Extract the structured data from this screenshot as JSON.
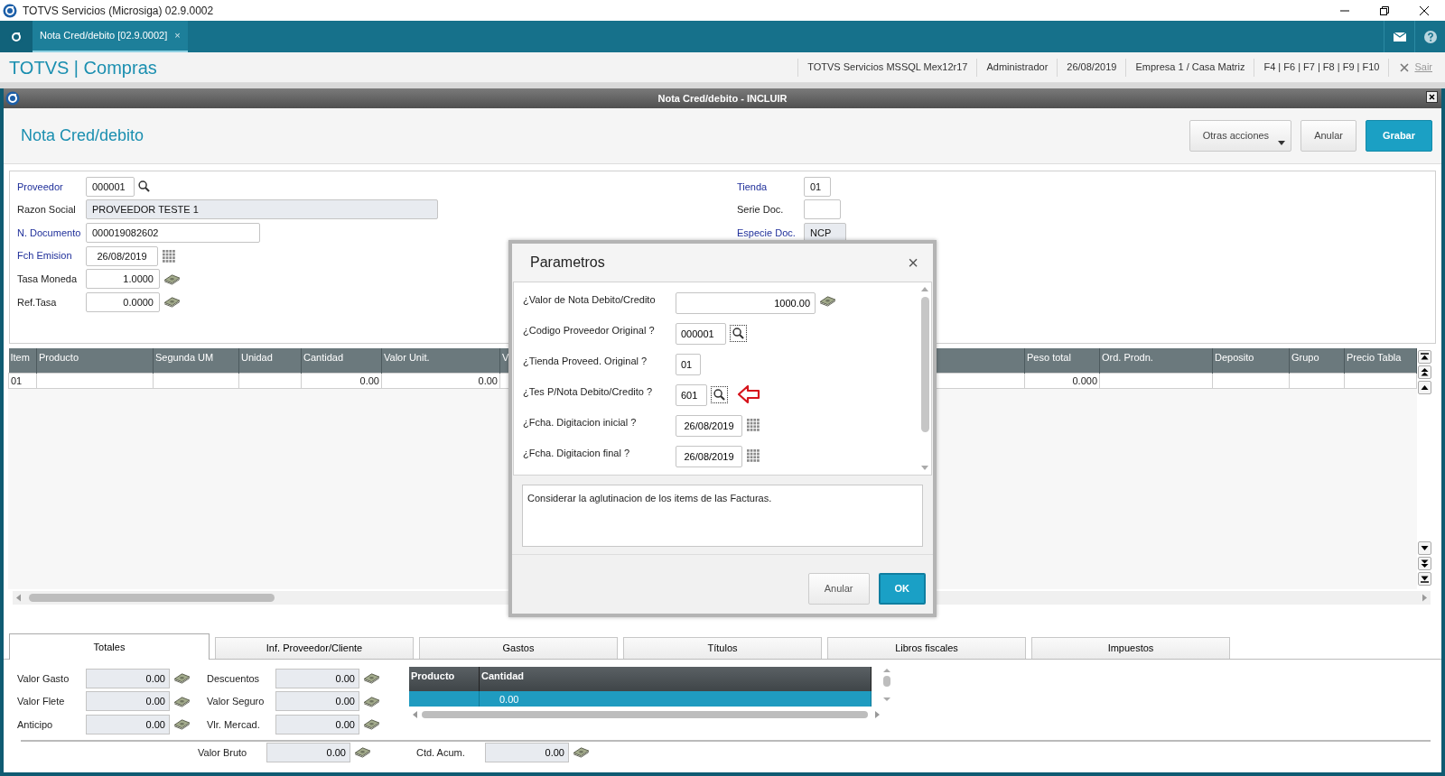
{
  "app_window": {
    "title": "TOTVS Servicios (Microsiga) 02.9.0002"
  },
  "tabs": [
    {
      "label": "Nota Cred/debito [02.9.0002]",
      "selected": true,
      "close": "×"
    }
  ],
  "module_bar": {
    "title": "TOTVS | Compras",
    "info": [
      "TOTVS Servicios MSSQL Mex12r17",
      "Administrador",
      "26/08/2019",
      "Empresa 1 / Casa Matriz",
      "F4 | F6 | F7 | F8 | F9 | F10"
    ],
    "exit": "Sair"
  },
  "window": {
    "title": "Nota Cred/debito - INCLUIR",
    "heading": "Nota Cred/debito",
    "actions": [
      {
        "label": "Otras acciones",
        "kind": "menu"
      },
      {
        "label": "Anular",
        "kind": "secondary"
      },
      {
        "label": "Grabar",
        "kind": "primary"
      }
    ]
  },
  "form": {
    "left": [
      {
        "label": "Proveedor",
        "required": true,
        "value": "000001",
        "kind": "lookup"
      },
      {
        "label": "Razon Social",
        "required": false,
        "value": "PROVEEDOR TESTE 1",
        "kind": "readonly"
      },
      {
        "label": "N. Documento",
        "required": true,
        "value": "000019082602",
        "kind": "text"
      },
      {
        "label": "Fch Emision",
        "required": true,
        "value": "26/08/2019",
        "kind": "date"
      },
      {
        "label": "Tasa Moneda",
        "required": false,
        "value": "1.0000",
        "kind": "money"
      },
      {
        "label": "Ref.Tasa",
        "required": false,
        "value": "0.0000",
        "kind": "money"
      }
    ],
    "right": [
      {
        "label": "Tienda",
        "required": true,
        "value": "01",
        "kind": "code"
      },
      {
        "label": "Serie Doc.",
        "required": false,
        "kind": "code"
      },
      {
        "label": "Especie Doc.",
        "required": true,
        "value": "NCP",
        "kind": "readonly"
      }
    ]
  },
  "grid": {
    "columns": [
      "Item",
      "Producto",
      "Segunda UM",
      "Unidad",
      "Cantidad",
      "Valor Unit.",
      "V",
      null,
      "Peso total",
      "Ord. Prodn.",
      "Deposito",
      "Grupo",
      "Precio Tabla"
    ],
    "rows": [
      [
        "01",
        null,
        null,
        null,
        "0.00",
        "0.00",
        null,
        null,
        "0.000",
        null,
        null,
        null,
        null
      ]
    ]
  },
  "dialog": {
    "title": "Parametros",
    "close": "×",
    "params": [
      {
        "label": "¿Valor de Nota Debito/Credito",
        "value": "1000.00",
        "kind": "money",
        "highlighted": false
      },
      {
        "label": "¿Codigo Proveedor Original ?",
        "value": "000001",
        "kind": "lookup",
        "highlighted": false
      },
      {
        "label": "¿Tienda Proveed. Original ?",
        "value": "01",
        "kind": "text",
        "highlighted": false
      },
      {
        "label": "¿Tes P/Nota Debito/Credito ?",
        "value": "601",
        "kind": "lookup",
        "highlighted": true
      },
      {
        "label": "¿Fcha. Digitacion inicial ?",
        "value": "26/08/2019",
        "kind": "date",
        "highlighted": false
      },
      {
        "label": "¿Fcha. Digitacion final ?",
        "value": "26/08/2019",
        "kind": "date",
        "highlighted": false
      }
    ],
    "description": "Considerar la aglutinacion de los items de las Facturas.",
    "buttons": [
      {
        "label": "Anular",
        "kind": "secondary"
      },
      {
        "label": "OK",
        "kind": "primary"
      }
    ]
  },
  "footer_tabs": [
    {
      "label": "Totales",
      "selected": true
    },
    {
      "label": "Inf. Proveedor/Cliente",
      "selected": false
    },
    {
      "label": "Gastos",
      "selected": false
    },
    {
      "label": "Títulos",
      "selected": false
    },
    {
      "label": "Libros fiscales",
      "selected": false
    },
    {
      "label": "Impuestos",
      "selected": false
    }
  ],
  "totals": {
    "column_1": [
      {
        "label": "Valor Gasto",
        "value": "0.00"
      },
      {
        "label": "Valor Flete",
        "value": "0.00"
      },
      {
        "label": "Anticipo",
        "value": "0.00"
      }
    ],
    "column_2": [
      {
        "label": "Descuentos",
        "value": "0.00"
      },
      {
        "label": "Valor Seguro",
        "value": "0.00"
      },
      {
        "label": "Vlr. Mercad.",
        "value": "0.00"
      }
    ],
    "mini_grid": {
      "columns": [
        "Producto",
        "Cantidad"
      ],
      "rows": [
        {
          "cells": [
            null,
            "0.00"
          ],
          "selected": true
        }
      ]
    },
    "summary": [
      {
        "label": "Valor Bruto",
        "value": "0.00"
      },
      {
        "label": "Ctd. Acum.",
        "value": "0.00"
      }
    ]
  }
}
